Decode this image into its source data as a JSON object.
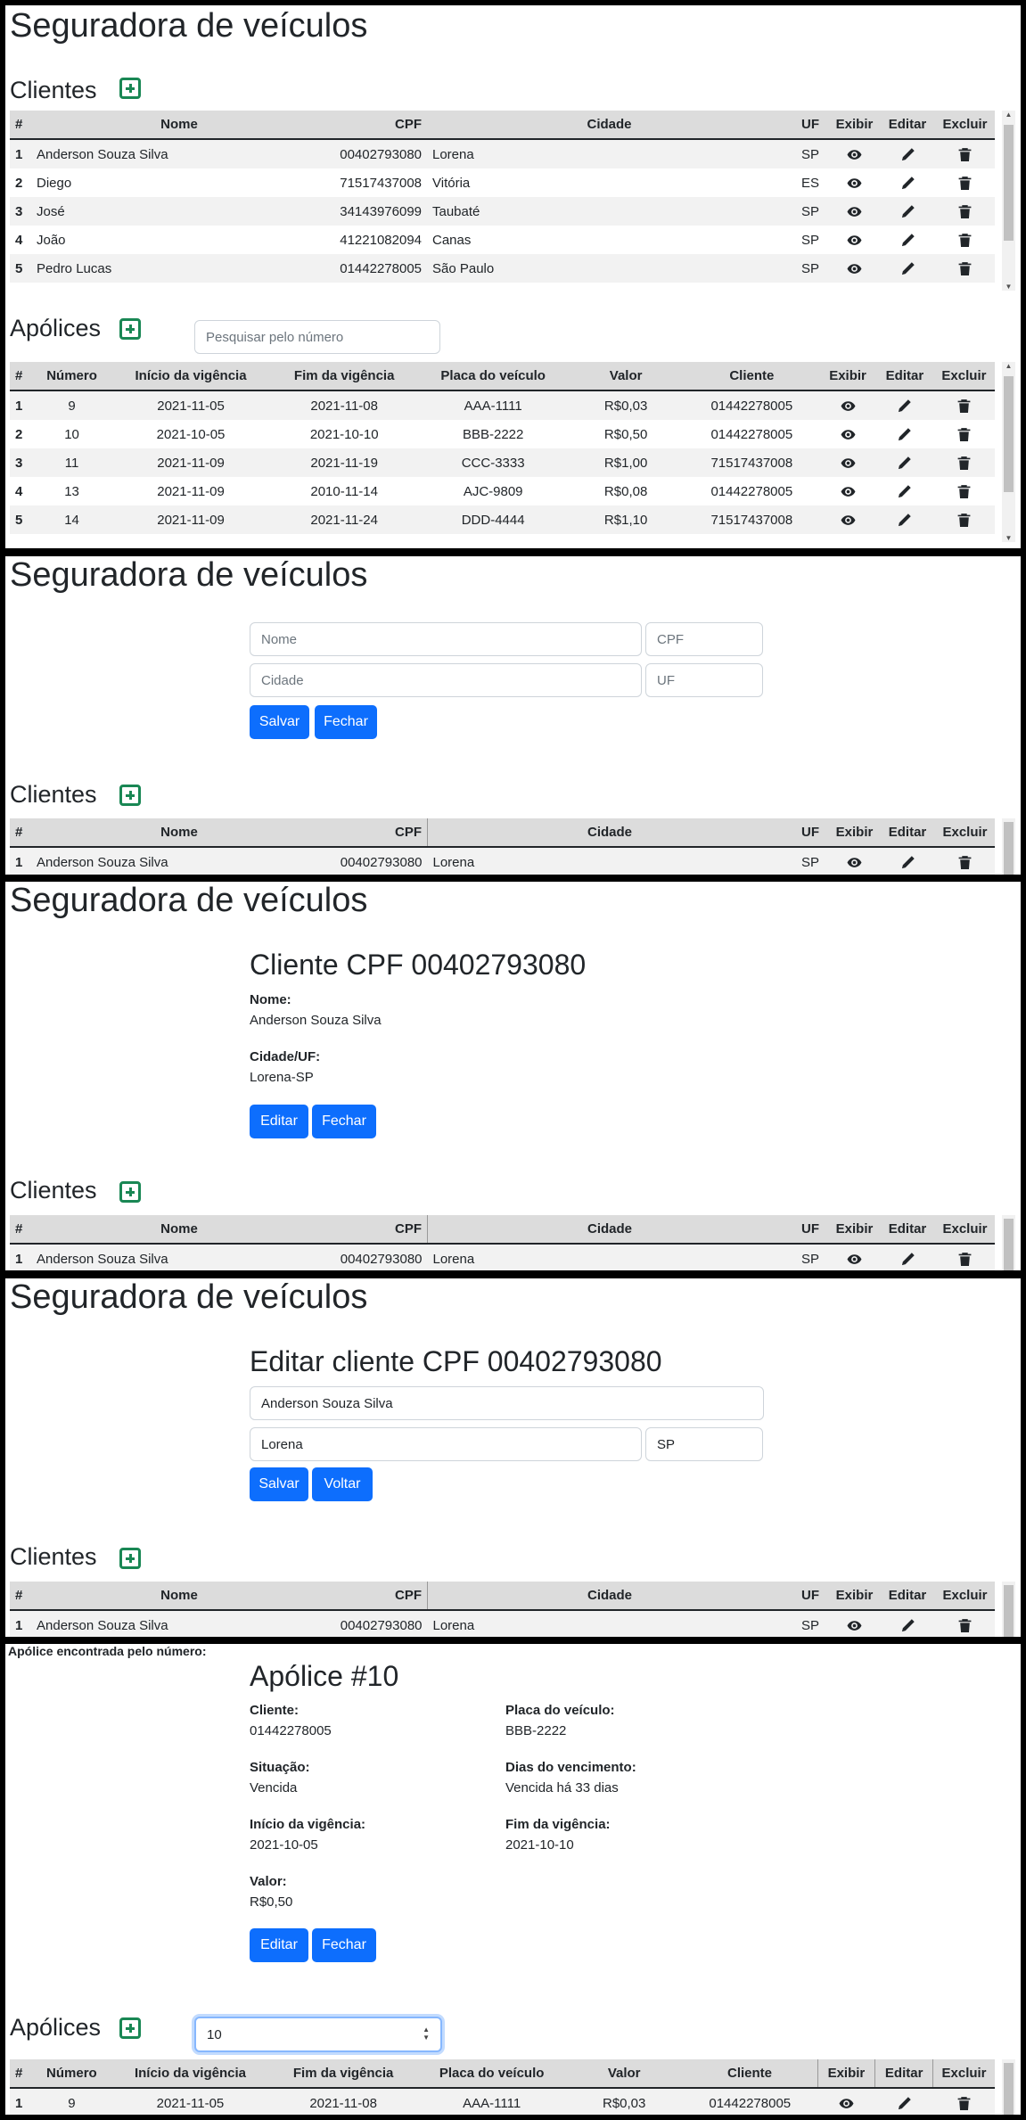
{
  "app_title": "Seguradora de veículos",
  "clientes_title": "Clientes",
  "apolices_title": "Apólices",
  "clientes_headers": [
    "#",
    "Nome",
    "CPF",
    "Cidade",
    "UF",
    "Exibir",
    "Editar",
    "Excluir"
  ],
  "clientes": [
    {
      "id": "1",
      "nome": "Anderson Souza Silva",
      "cpf": "00402793080",
      "cidade": "Lorena",
      "uf": "SP"
    },
    {
      "id": "2",
      "nome": "Diego",
      "cpf": "71517437008",
      "cidade": "Vitória",
      "uf": "ES"
    },
    {
      "id": "3",
      "nome": "José",
      "cpf": "34143976099",
      "cidade": "Taubaté",
      "uf": "SP"
    },
    {
      "id": "4",
      "nome": "João",
      "cpf": "41221082094",
      "cidade": "Canas",
      "uf": "SP"
    },
    {
      "id": "5",
      "nome": "Pedro Lucas",
      "cpf": "01442278005",
      "cidade": "São Paulo",
      "uf": "SP"
    }
  ],
  "apolices_headers": [
    "#",
    "Número",
    "Início da vigência",
    "Fim da vigência",
    "Placa do veículo",
    "Valor",
    "Cliente",
    "Exibir",
    "Editar",
    "Excluir"
  ],
  "apolices": [
    {
      "id": "1",
      "numero": "9",
      "inicio": "2021-11-05",
      "fim": "2021-11-08",
      "placa": "AAA-1111",
      "valor": "R$0,03",
      "cliente": "01442278005"
    },
    {
      "id": "2",
      "numero": "10",
      "inicio": "2021-10-05",
      "fim": "2021-10-10",
      "placa": "BBB-2222",
      "valor": "R$0,50",
      "cliente": "01442278005"
    },
    {
      "id": "3",
      "numero": "11",
      "inicio": "2021-11-09",
      "fim": "2021-11-19",
      "placa": "CCC-3333",
      "valor": "R$1,00",
      "cliente": "71517437008"
    },
    {
      "id": "4",
      "numero": "13",
      "inicio": "2021-11-09",
      "fim": "2010-11-14",
      "placa": "AJC-9809",
      "valor": "R$0,08",
      "cliente": "01442278005"
    },
    {
      "id": "5",
      "numero": "14",
      "inicio": "2021-11-09",
      "fim": "2021-11-24",
      "placa": "DDD-4444",
      "valor": "R$1,10",
      "cliente": "71517437008"
    }
  ],
  "search_placeholder": "Pesquisar pelo número",
  "search_value": "10",
  "new_form": {
    "nome_ph": "Nome",
    "cpf_ph": "CPF",
    "cidade_ph": "Cidade",
    "uf_ph": "UF",
    "save": "Salvar",
    "close": "Fechar"
  },
  "view_client": {
    "title": "Cliente CPF 00402793080",
    "nome_label": "Nome:",
    "nome": "Anderson Souza Silva",
    "cidade_label": "Cidade/UF:",
    "cidade": "Lorena-SP",
    "edit": "Editar",
    "close": "Fechar"
  },
  "edit_client": {
    "title": "Editar cliente CPF 00402793080",
    "nome": "Anderson Souza Silva",
    "cidade": "Lorena",
    "uf": "SP",
    "save": "Salvar",
    "back": "Voltar"
  },
  "policy": {
    "found_text": "Apólice encontrada pelo número:",
    "title": "Apólice #10",
    "cliente_label": "Cliente:",
    "cliente": "01442278005",
    "placa_label": "Placa do veículo:",
    "placa": "BBB-2222",
    "situacao_label": "Situação:",
    "situacao": "Vencida",
    "dias_label": "Dias do vencimento:",
    "dias": "Vencida há 33 dias",
    "inicio_label": "Início da vigência:",
    "inicio": "2021-10-05",
    "fim_label": "Fim da vigência:",
    "fim": "2021-10-10",
    "valor_label": "Valor:",
    "valor": "R$0,50",
    "edit": "Editar",
    "close": "Fechar"
  }
}
